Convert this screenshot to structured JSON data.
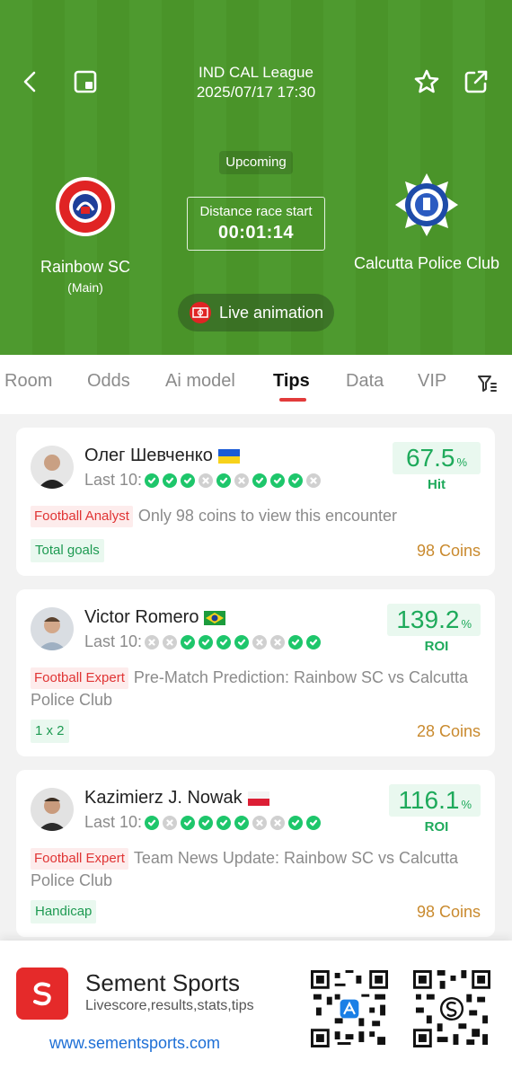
{
  "header": {
    "league": "IND CAL League",
    "datetime": "2025/07/17 17:30",
    "status": "Upcoming",
    "countdown_label": "Distance race start",
    "countdown_value": "00:01:14",
    "home": {
      "name": "Rainbow SC",
      "sub": "(Main)",
      "logo_text": "RAINBOW S.C. BAMENDA"
    },
    "away": {
      "name": "Calcutta Police Club",
      "logo_text": "KOLKATA POLICE"
    },
    "live_button": "Live animation"
  },
  "tabs": [
    "Room",
    "Odds",
    "Ai model",
    "Tips",
    "Data",
    "VIP"
  ],
  "active_tab": "Tips",
  "last10_label": "Last 10:",
  "tips": [
    {
      "name": "Олег Шевченко",
      "flag": "ukraine",
      "results": [
        "W",
        "W",
        "W",
        "L",
        "W",
        "L",
        "W",
        "W",
        "W",
        "L"
      ],
      "stat_value": "67.5",
      "stat_unit": "%",
      "stat_label": "Hit",
      "badge": "Football Analyst",
      "text": "Only 98 coins to view this encounter",
      "tag": "Total goals",
      "price": "98 Coins"
    },
    {
      "name": "Victor Romero",
      "flag": "brazil",
      "results": [
        "L",
        "L",
        "W",
        "W",
        "W",
        "W",
        "L",
        "L",
        "W",
        "W"
      ],
      "stat_value": "139.2",
      "stat_unit": "%",
      "stat_label": "ROI",
      "badge": "Football Expert",
      "text": "Pre-Match Prediction: Rainbow SC vs Calcutta Police Club",
      "tag": "1 x 2",
      "price": "28 Coins"
    },
    {
      "name": "Kazimierz J. Nowak",
      "flag": "poland",
      "results": [
        "W",
        "L",
        "W",
        "W",
        "W",
        "W",
        "L",
        "L",
        "W",
        "W"
      ],
      "stat_value": "116.1",
      "stat_unit": "%",
      "stat_label": "ROI",
      "badge": "Football Expert",
      "text": "Team News Update: Rainbow SC vs Calcutta Police Club",
      "tag": "Handicap",
      "price": "98 Coins"
    }
  ],
  "banner": {
    "app_name": "Sement Sports",
    "tagline": "Livescore,results,stats,tips",
    "url": "www.sementsports.com"
  },
  "colors": {
    "pitch": "#4e9a2f",
    "accent_red": "#e23b3b",
    "win": "#1ec66b",
    "loss": "#d0d0d0",
    "coins": "#c98a2e"
  }
}
